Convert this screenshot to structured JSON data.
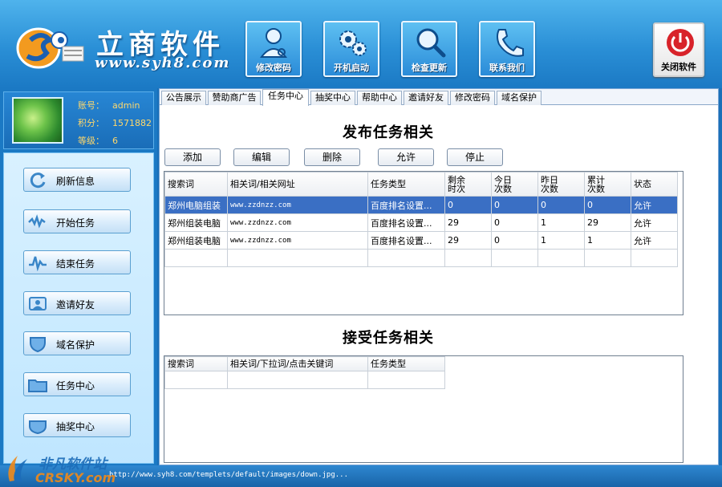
{
  "header": {
    "brand_title": "立商软件",
    "brand_url": "www.syh8.com",
    "toolbar": [
      {
        "label": "修改密码",
        "icon": "user-key-icon"
      },
      {
        "label": "开机启动",
        "icon": "gears-icon"
      },
      {
        "label": "检查更新",
        "icon": "magnifier-icon"
      },
      {
        "label": "联系我们",
        "icon": "phone-icon"
      }
    ],
    "close_label": "关闭软件"
  },
  "profile": {
    "account_label": "账号：",
    "account_value": "admin",
    "points_label": "积分：",
    "points_value": "1571882",
    "level_label": "等级：",
    "level_value": "6"
  },
  "sidebar": {
    "items": [
      {
        "label": "刷新信息",
        "icon": "refresh-icon"
      },
      {
        "label": "开始任务",
        "icon": "start-task-icon"
      },
      {
        "label": "结束任务",
        "icon": "end-task-icon"
      },
      {
        "label": "邀请好友",
        "icon": "invite-icon"
      },
      {
        "label": "域名保护",
        "icon": "shield-icon"
      },
      {
        "label": "任务中心",
        "icon": "folder-icon"
      },
      {
        "label": "抽奖中心",
        "icon": "lottery-icon"
      }
    ]
  },
  "tabs": [
    "公告展示",
    "赞助商广告",
    "任务中心",
    "抽奖中心",
    "帮助中心",
    "邀请好友",
    "修改密码",
    "域名保护"
  ],
  "active_tab": "任务中心",
  "publish": {
    "title": "发布任务相关",
    "buttons": [
      "添加",
      "编辑",
      "删除",
      "允许",
      "停止"
    ],
    "columns": [
      "搜索词",
      "相关词/相关网址",
      "任务类型",
      "剩余\n时次",
      "今日\n次数",
      "昨日\n次数",
      "累计\n次数",
      "状态"
    ],
    "rows": [
      [
        "郑州电脑组装",
        "www.zzdnzz.com",
        "百度排名设置...",
        "0",
        "0",
        "0",
        "0",
        "允许"
      ],
      [
        "郑州组装电脑",
        "www.zzdnzz.com",
        "百度排名设置...",
        "29",
        "0",
        "1",
        "29",
        "允许"
      ],
      [
        "郑州组装电脑",
        "www.zzdnzz.com",
        "百度排名设置...",
        "29",
        "0",
        "1",
        "1",
        "允许"
      ]
    ],
    "selected_row": 0
  },
  "receive": {
    "title": "接受任务相关",
    "columns": [
      "搜索词",
      "相关词/下拉词/点击关键词",
      "任务类型"
    ]
  },
  "status_bar": {
    "text": "http://www.syh8.com/templets/default/images/down.jpg..."
  },
  "watermark": {
    "cn": "非凡软件站",
    "en": "CRSKY.com"
  },
  "colors": {
    "header_blue": "#2a8fd6",
    "selection_blue": "#3a6fc4",
    "profile_text": "#ffd86b",
    "close_red": "#d8232a"
  }
}
